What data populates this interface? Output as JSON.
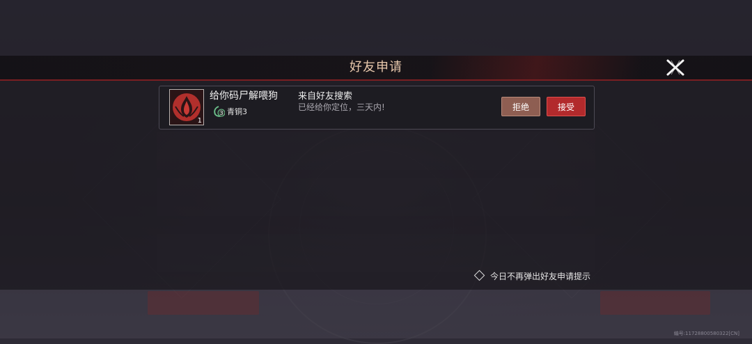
{
  "dialog": {
    "title": "好友申请",
    "close_icon": "close-x-icon"
  },
  "request": {
    "player_name": "给你码尸解喂狗",
    "avatar_level": "1",
    "rank_icon": "bronze-rank-icon",
    "rank_badge": "3",
    "rank": "青铜3",
    "source": "来自好友搜索",
    "message": "已经给你定位，三天内!",
    "reject_label": "拒绝",
    "accept_label": "接受"
  },
  "option": {
    "label": "今日不再弹出好友申请提示",
    "checked": false
  },
  "footer": {
    "serial": "编号:11728800580322[CN]"
  },
  "colors": {
    "accent_red": "#b22a2c",
    "reject_brown": "#8e5e52",
    "title_gold": "#e9c9ad"
  }
}
